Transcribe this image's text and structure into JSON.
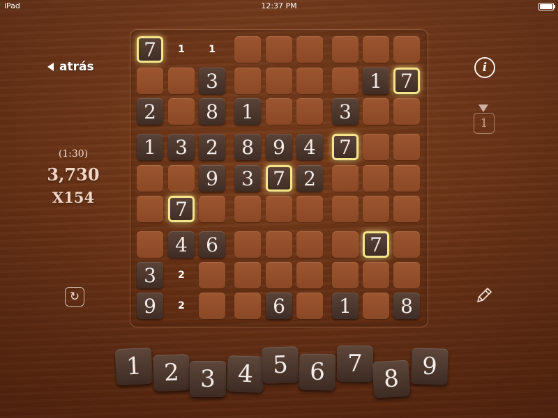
{
  "status_bar": {
    "device": "iPad",
    "time": "12:37 PM"
  },
  "nav": {
    "back_label": "atrás"
  },
  "stats": {
    "timer": "(1:30)",
    "score": "3,730",
    "multiplier": "X154"
  },
  "hint": {
    "count": "1"
  },
  "colors": {
    "highlight": "#f5e58a",
    "tile": "#4a372d",
    "wood": "#7c3e1c"
  },
  "icons": {
    "info": "i",
    "refresh": "↻",
    "pencil": "pencil-icon"
  },
  "board": {
    "rows": [
      [
        "7",
        "n:1",
        "n:1",
        "",
        "",
        "",
        "",
        "",
        ""
      ],
      [
        "",
        "",
        "3",
        "",
        "",
        "",
        "",
        "1",
        "7"
      ],
      [
        "2",
        "",
        "8",
        "1",
        "",
        "",
        "3",
        "",
        ""
      ],
      [
        "1",
        "3",
        "2",
        "8",
        "9",
        "4",
        "7",
        "",
        ""
      ],
      [
        "",
        "",
        "9",
        "3",
        "7",
        "2",
        "",
        "",
        ""
      ],
      [
        "",
        "7",
        "",
        "",
        "",
        "",
        "",
        "",
        ""
      ],
      [
        "",
        "4",
        "6",
        "",
        "",
        "",
        "",
        "7",
        ""
      ],
      [
        "3",
        "n:2",
        "",
        "",
        "",
        "",
        "",
        "",
        ""
      ],
      [
        "9",
        "n:2",
        "",
        "",
        "6",
        "",
        "1",
        "",
        "8"
      ]
    ],
    "highlighted": [
      [
        0,
        0
      ],
      [
        1,
        8
      ],
      [
        3,
        6
      ],
      [
        4,
        4
      ],
      [
        5,
        1
      ],
      [
        6,
        7
      ]
    ]
  },
  "number_tiles": [
    "1",
    "2",
    "3",
    "4",
    "5",
    "6",
    "7",
    "8",
    "9"
  ]
}
